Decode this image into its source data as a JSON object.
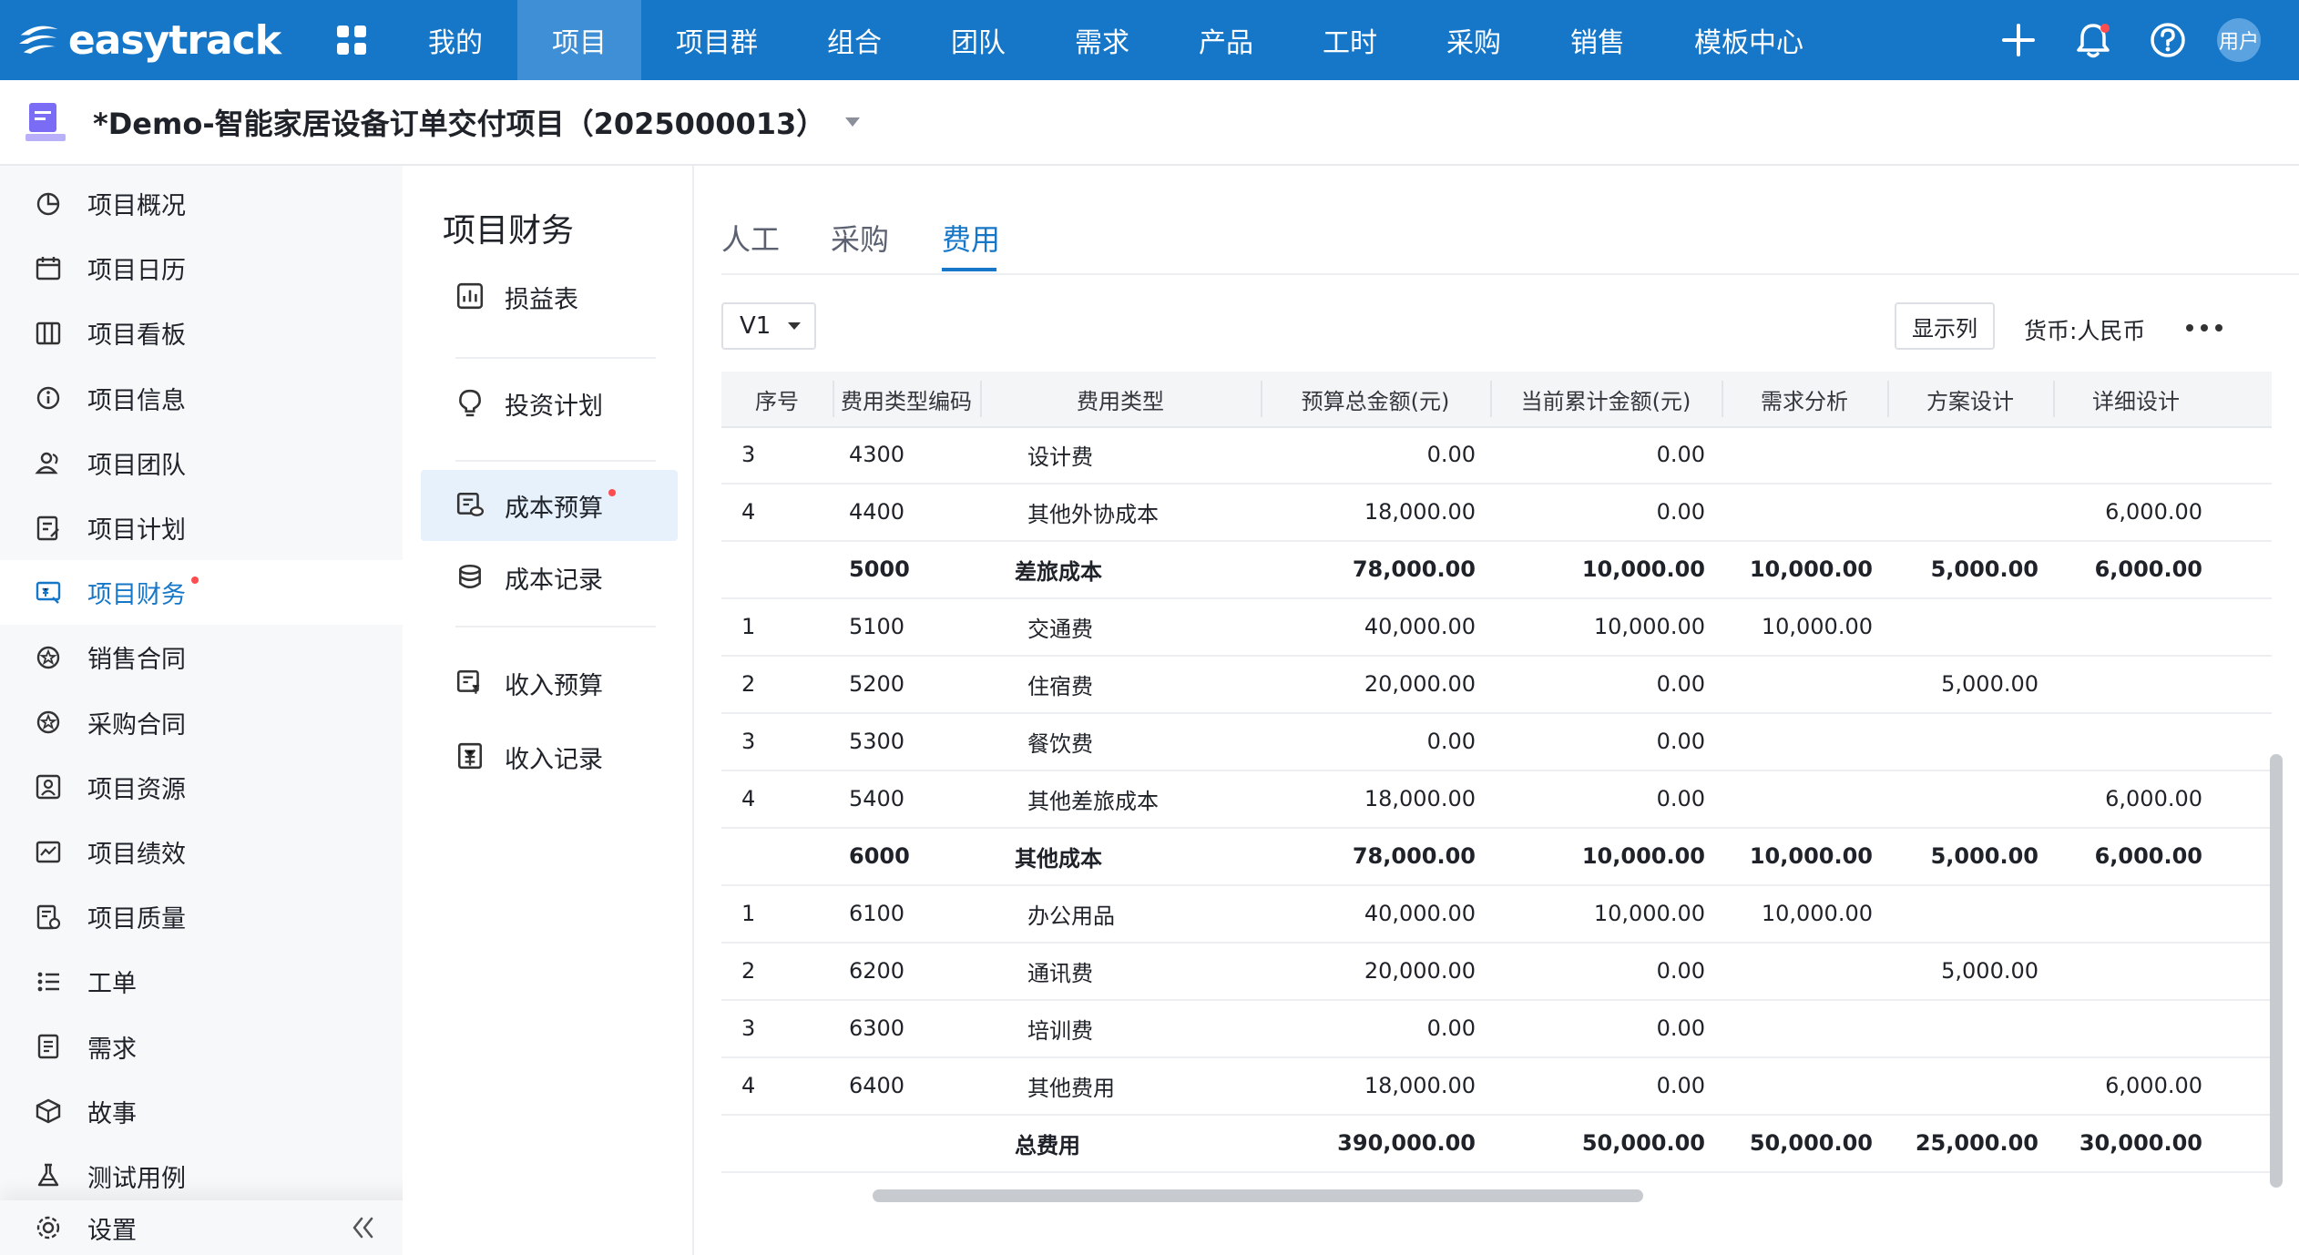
{
  "brand": {
    "name": "easytrack"
  },
  "topnav": {
    "items": [
      "我的",
      "项目",
      "项目群",
      "组合",
      "团队",
      "需求",
      "产品",
      "工时",
      "采购",
      "销售",
      "模板中心"
    ],
    "active": "项目",
    "avatar_label": "用户"
  },
  "project": {
    "title": "*Demo-智能家居设备订单交付项目（2025000013）"
  },
  "sidebar": {
    "items": [
      {
        "label": "项目概况",
        "icon": "pie-chart-icon"
      },
      {
        "label": "项目日历",
        "icon": "calendar-icon"
      },
      {
        "label": "项目看板",
        "icon": "kanban-icon"
      },
      {
        "label": "项目信息",
        "icon": "info-icon"
      },
      {
        "label": "项目团队",
        "icon": "team-icon"
      },
      {
        "label": "项目计划",
        "icon": "plan-icon"
      },
      {
        "label": "项目财务",
        "icon": "finance-icon"
      },
      {
        "label": "销售合同",
        "icon": "sales-contract-icon"
      },
      {
        "label": "采购合同",
        "icon": "purchase-contract-icon"
      },
      {
        "label": "项目资源",
        "icon": "resource-icon"
      },
      {
        "label": "项目绩效",
        "icon": "performance-icon"
      },
      {
        "label": "项目质量",
        "icon": "quality-icon"
      },
      {
        "label": "工单",
        "icon": "work-order-icon"
      },
      {
        "label": "需求",
        "icon": "requirement-icon"
      },
      {
        "label": "故事",
        "icon": "story-icon"
      },
      {
        "label": "测试用例",
        "icon": "test-case-icon"
      }
    ],
    "active_index": 6,
    "settings_label": "设置"
  },
  "finance_menu": {
    "title": "项目财务",
    "items": [
      {
        "label": "损益表",
        "icon": "profit-loss-icon"
      },
      {
        "label": "投资计划",
        "icon": "bulb-icon"
      },
      {
        "label": "成本预算",
        "icon": "cost-budget-icon"
      },
      {
        "label": "成本记录",
        "icon": "cost-record-icon"
      },
      {
        "label": "收入预算",
        "icon": "income-budget-icon"
      },
      {
        "label": "收入记录",
        "icon": "income-record-icon"
      }
    ],
    "active_index": 2
  },
  "tabs": {
    "items": [
      "人工",
      "采购",
      "费用"
    ],
    "active_index": 2
  },
  "toolbar": {
    "version": "V1",
    "show_columns": "显示列",
    "currency": "货币:人民币"
  },
  "table": {
    "headers": [
      "序号",
      "费用类型编码",
      "费用类型",
      "预算总金额(元)",
      "当前累计金额(元)",
      "需求分析",
      "方案设计",
      "详细设计"
    ],
    "rows": [
      {
        "no": "3",
        "code": "4300",
        "type": "设计费",
        "budget": "0.00",
        "current": "0.00",
        "req": "",
        "plan": "",
        "detail": "",
        "bold": false
      },
      {
        "no": "4",
        "code": "4400",
        "type": "其他外协成本",
        "budget": "18,000.00",
        "current": "0.00",
        "req": "",
        "plan": "",
        "detail": "6,000.00",
        "bold": false
      },
      {
        "no": "",
        "code": "5000",
        "type": "差旅成本",
        "budget": "78,000.00",
        "current": "10,000.00",
        "req": "10,000.00",
        "plan": "5,000.00",
        "detail": "6,000.00",
        "bold": true
      },
      {
        "no": "1",
        "code": "5100",
        "type": "交通费",
        "budget": "40,000.00",
        "current": "10,000.00",
        "req": "10,000.00",
        "plan": "",
        "detail": "",
        "bold": false
      },
      {
        "no": "2",
        "code": "5200",
        "type": "住宿费",
        "budget": "20,000.00",
        "current": "0.00",
        "req": "",
        "plan": "5,000.00",
        "detail": "",
        "bold": false
      },
      {
        "no": "3",
        "code": "5300",
        "type": "餐饮费",
        "budget": "0.00",
        "current": "0.00",
        "req": "",
        "plan": "",
        "detail": "",
        "bold": false
      },
      {
        "no": "4",
        "code": "5400",
        "type": "其他差旅成本",
        "budget": "18,000.00",
        "current": "0.00",
        "req": "",
        "plan": "",
        "detail": "6,000.00",
        "bold": false
      },
      {
        "no": "",
        "code": "6000",
        "type": "其他成本",
        "budget": "78,000.00",
        "current": "10,000.00",
        "req": "10,000.00",
        "plan": "5,000.00",
        "detail": "6,000.00",
        "bold": true
      },
      {
        "no": "1",
        "code": "6100",
        "type": "办公用品",
        "budget": "40,000.00",
        "current": "10,000.00",
        "req": "10,000.00",
        "plan": "",
        "detail": "",
        "bold": false
      },
      {
        "no": "2",
        "code": "6200",
        "type": "通讯费",
        "budget": "20,000.00",
        "current": "0.00",
        "req": "",
        "plan": "5,000.00",
        "detail": "",
        "bold": false
      },
      {
        "no": "3",
        "code": "6300",
        "type": "培训费",
        "budget": "0.00",
        "current": "0.00",
        "req": "",
        "plan": "",
        "detail": "",
        "bold": false
      },
      {
        "no": "4",
        "code": "6400",
        "type": "其他费用",
        "budget": "18,000.00",
        "current": "0.00",
        "req": "",
        "plan": "",
        "detail": "6,000.00",
        "bold": false
      },
      {
        "no": "",
        "code": "",
        "type": "总费用",
        "budget": "390,000.00",
        "current": "50,000.00",
        "req": "50,000.00",
        "plan": "25,000.00",
        "detail": "30,000.00",
        "bold": true
      }
    ]
  },
  "colors": {
    "primary": "#1677c9",
    "nav_active": "#3f8fd6",
    "dot": "#ff4d4f"
  }
}
